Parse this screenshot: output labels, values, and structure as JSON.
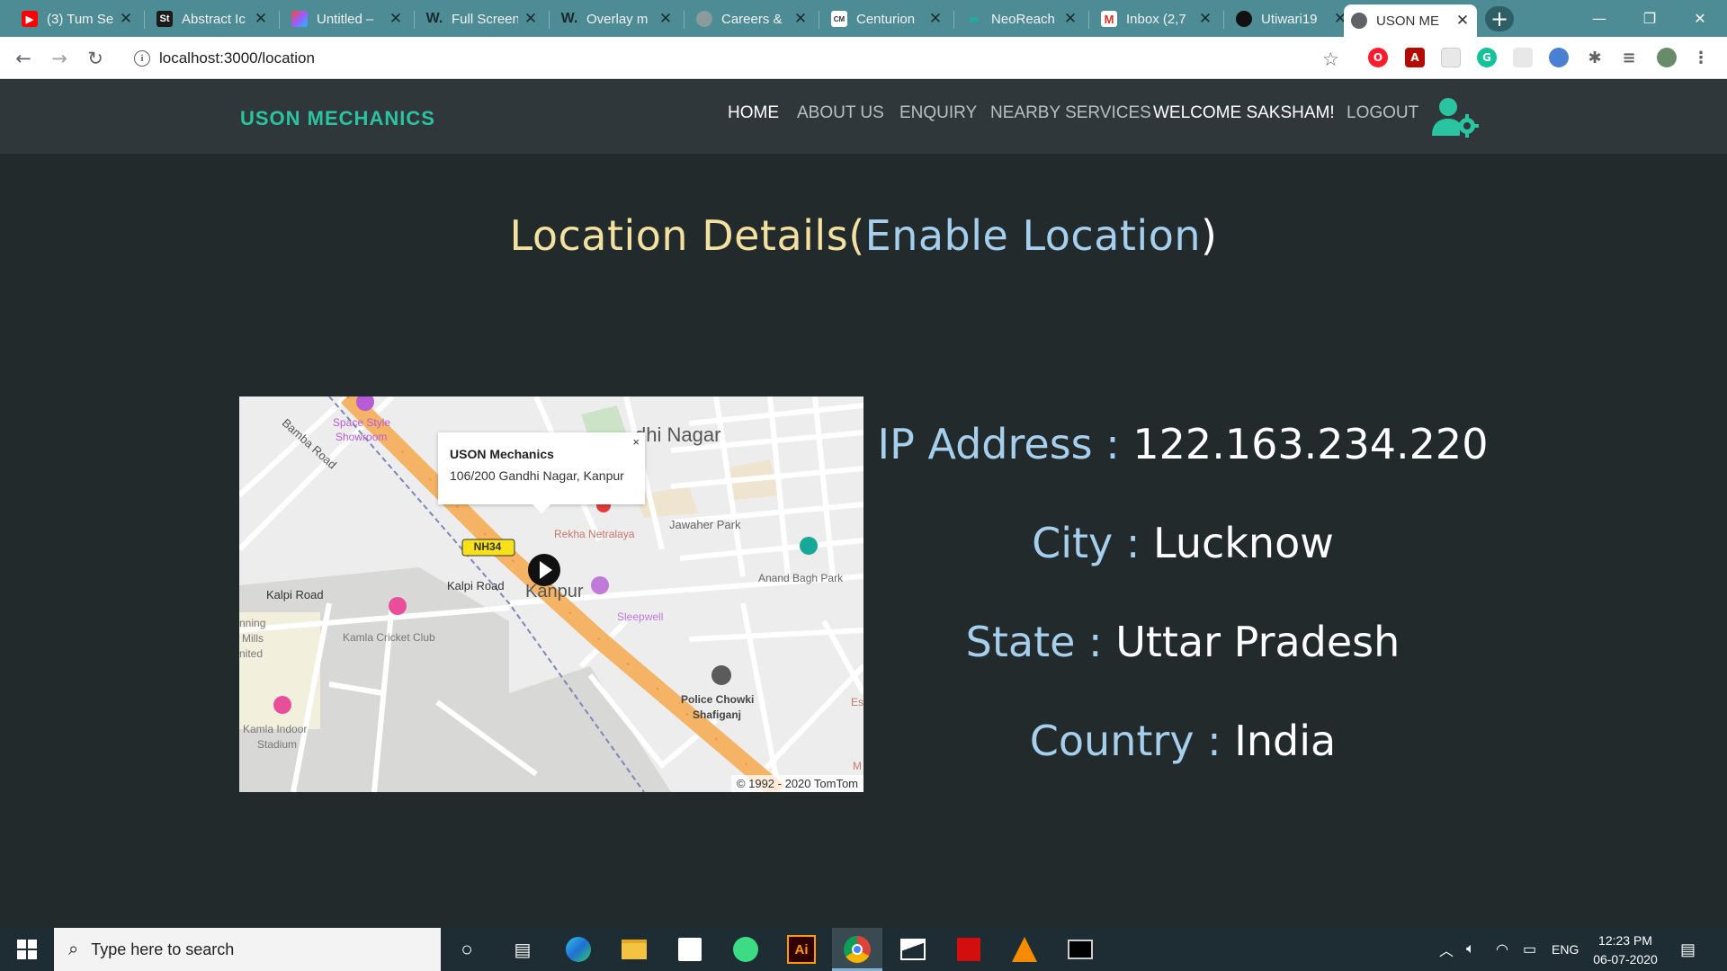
{
  "browser": {
    "tabs": [
      {
        "title": "(3) Tum Se",
        "icon": "youtube-icon",
        "color": "#ff0000"
      },
      {
        "title": "Abstract Ic",
        "icon": "st-icon",
        "color": "#1a1a1a"
      },
      {
        "title": "Untitled –",
        "icon": "figma-icon",
        "color": "#a259ff"
      },
      {
        "title": "Full Screen",
        "icon": "w-icon",
        "color": "#ffffff"
      },
      {
        "title": "Overlay m",
        "icon": "w-icon",
        "color": "#ffffff"
      },
      {
        "title": "Careers &",
        "icon": "globe-icon",
        "color": "#cccccc"
      },
      {
        "title": "Centurion",
        "icon": "cm-icon",
        "color": "#ffffff"
      },
      {
        "title": "NeoReach",
        "icon": "neoreach-icon",
        "color": "#00c4a7"
      },
      {
        "title": "Inbox (2,7",
        "icon": "gmail-icon",
        "color": "#d93025"
      },
      {
        "title": "Utiwari19",
        "icon": "github-icon",
        "color": "#111111"
      },
      {
        "title": "USON ME",
        "icon": "globe-icon",
        "color": "#5f6368",
        "active": true
      }
    ],
    "new_tab_label": "+",
    "controls": {
      "minimize": "—",
      "maximize": "❐",
      "close": "✕"
    },
    "url": "localhost:3000/location"
  },
  "site": {
    "brand": "USON MECHANICS",
    "nav": {
      "home": "HOME",
      "about": "ABOUT US",
      "enquiry": "ENQUIRY",
      "nearby": "NEARBY SERVICES",
      "welcome": "WELCOME SAKSHAM!",
      "logout": "LOGOUT"
    },
    "accent": "#2ac4a0"
  },
  "page": {
    "title": "Location Details",
    "enable_link": "Enable Location",
    "info": {
      "ip_label": "IP Address :",
      "ip_value": "122.163.234.220",
      "city_label": "City :",
      "city_value": "Lucknow",
      "state_label": "State :",
      "state_value": "Uttar Pradesh",
      "country_label": "Country :",
      "country_value": "India"
    }
  },
  "map": {
    "popup_title": "USON Mechanics",
    "popup_address": "106/200 Gandhi Nagar, Kanpur",
    "popup_close": "×",
    "copyright": "© 1992 - 2020 TomTom",
    "labels": {
      "gandhi_nagar": "dhi Nagar",
      "bamba_road": "Bamba Road",
      "space_style": "Space Style",
      "showroom": "Showroom",
      "jawaher_park": "Jawaher Park",
      "rekha": "Rekha Netralaya",
      "nh34": "NH34",
      "anand_bagh": "Anand Bagh Park",
      "kalpi_road_left": "Kalpi Road",
      "kalpi_road_mid": "Kalpi Road",
      "kanpur": "Kanpur",
      "sleepwell": "Sleepwell",
      "mills_1": "nning",
      "mills_2": "Mills",
      "mills_3": "nited",
      "kamla_cricket": "Kamla Cricket Club",
      "kamla_indoor_1": "Kamla Indoor",
      "kamla_indoor_2": "Stadium",
      "police_1": "Police Chowki",
      "police_2": "Shafiganj",
      "es": "Es",
      "m": "M"
    }
  },
  "taskbar": {
    "search_placeholder": "Type here to search",
    "language": "ENG",
    "time": "12:23 PM",
    "date": "06-07-2020",
    "ai_label": "Ai"
  }
}
